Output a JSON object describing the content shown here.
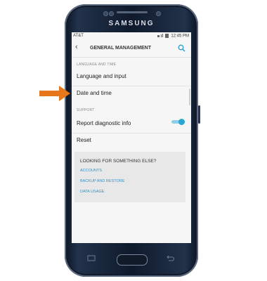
{
  "device": {
    "brand": "SAMSUNG"
  },
  "status_bar": {
    "carrier": "AT&T",
    "time": "12:45 PM",
    "icons": [
      "mute-icon",
      "signal-icon",
      "battery-icon"
    ]
  },
  "header": {
    "title": "GENERAL MANAGEMENT",
    "back_icon": "back-arrow-icon",
    "search_icon": "search-icon"
  },
  "sections": [
    {
      "label": "LANGUAGE AND TIME",
      "items": [
        "Language and input",
        "Date and time"
      ]
    },
    {
      "label": "SUPPORT",
      "items": [
        "Report diagnostic info",
        "Reset"
      ]
    }
  ],
  "toggle": {
    "state": "on",
    "accent_color": "#2aa6d3"
  },
  "looking_box": {
    "heading": "LOOKING FOR SOMETHING ELSE?",
    "links": [
      "ACCOUNTS",
      "BACKUP AND RESTORE",
      "DATA USAGE"
    ]
  },
  "highlight": {
    "icon": "pointer-arrow-icon",
    "color": "#e8761a",
    "target": "Date and time"
  }
}
